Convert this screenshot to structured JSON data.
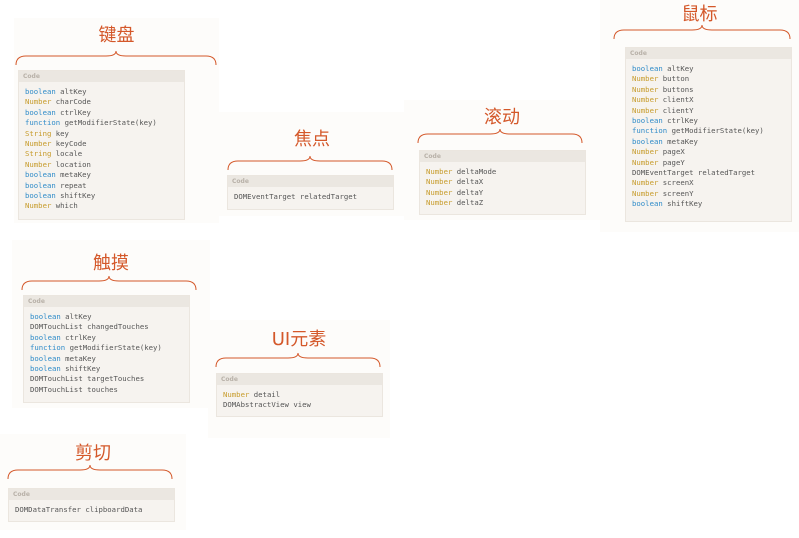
{
  "code_header": "Code",
  "accent_color": "#d4582a",
  "groups": {
    "keyboard": {
      "title": "键盘",
      "props": [
        {
          "type": "boolean",
          "name": "altKey"
        },
        {
          "type": "Number",
          "name": "charCode"
        },
        {
          "type": "boolean",
          "name": "ctrlKey"
        },
        {
          "type": "function",
          "name": "getModifierState(key)"
        },
        {
          "type": "String",
          "name": "key"
        },
        {
          "type": "Number",
          "name": "keyCode"
        },
        {
          "type": "String",
          "name": "locale"
        },
        {
          "type": "Number",
          "name": "location"
        },
        {
          "type": "boolean",
          "name": "metaKey"
        },
        {
          "type": "boolean",
          "name": "repeat"
        },
        {
          "type": "boolean",
          "name": "shiftKey"
        },
        {
          "type": "Number",
          "name": "which"
        }
      ]
    },
    "focus": {
      "title": "焦点",
      "props": [
        {
          "type": "DOMEventTarget",
          "name": "relatedTarget"
        }
      ]
    },
    "scroll": {
      "title": "滚动",
      "props": [
        {
          "type": "Number",
          "name": "deltaMode"
        },
        {
          "type": "Number",
          "name": "deltaX"
        },
        {
          "type": "Number",
          "name": "deltaY"
        },
        {
          "type": "Number",
          "name": "deltaZ"
        }
      ]
    },
    "mouse": {
      "title": "鼠标",
      "props": [
        {
          "type": "boolean",
          "name": "altKey"
        },
        {
          "type": "Number",
          "name": "button"
        },
        {
          "type": "Number",
          "name": "buttons"
        },
        {
          "type": "Number",
          "name": "clientX"
        },
        {
          "type": "Number",
          "name": "clientY"
        },
        {
          "type": "boolean",
          "name": "ctrlKey"
        },
        {
          "type": "function",
          "name": "getModifierState(key)"
        },
        {
          "type": "boolean",
          "name": "metaKey"
        },
        {
          "type": "Number",
          "name": "pageX"
        },
        {
          "type": "Number",
          "name": "pageY"
        },
        {
          "type": "DOMEventTarget",
          "name": "relatedTarget"
        },
        {
          "type": "Number",
          "name": "screenX"
        },
        {
          "type": "Number",
          "name": "screenY"
        },
        {
          "type": "boolean",
          "name": "shiftKey"
        }
      ]
    },
    "touch": {
      "title": "触摸",
      "props": [
        {
          "type": "boolean",
          "name": "altKey"
        },
        {
          "type": "DOMTouchList",
          "name": "changedTouches"
        },
        {
          "type": "boolean",
          "name": "ctrlKey"
        },
        {
          "type": "function",
          "name": "getModifierState(key)"
        },
        {
          "type": "boolean",
          "name": "metaKey"
        },
        {
          "type": "boolean",
          "name": "shiftKey"
        },
        {
          "type": "DOMTouchList",
          "name": "targetTouches"
        },
        {
          "type": "DOMTouchList",
          "name": "touches"
        }
      ]
    },
    "ui": {
      "title": "UI元素",
      "props": [
        {
          "type": "Number",
          "name": "detail"
        },
        {
          "type": "DOMAbstractView",
          "name": "view"
        }
      ]
    },
    "clipboard": {
      "title": "剪切",
      "props": [
        {
          "type": "DOMDataTransfer",
          "name": "clipboardData"
        }
      ]
    }
  }
}
